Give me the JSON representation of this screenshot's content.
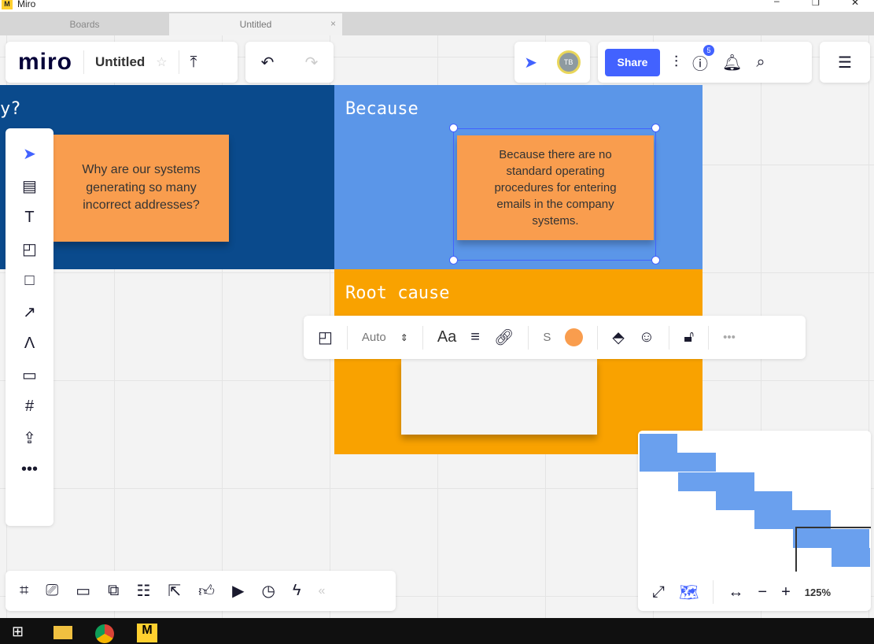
{
  "window": {
    "title": "Miro"
  },
  "tabs": [
    {
      "label": "Boards"
    },
    {
      "label": "Untitled"
    }
  ],
  "header": {
    "logo": "miro",
    "board_name": "Untitled",
    "share_label": "Share",
    "avatar_initials": "TB",
    "help_badge": "5"
  },
  "frames": [
    {
      "title": "y?"
    },
    {
      "title": "Because"
    },
    {
      "title": "Root cause"
    }
  ],
  "stickies": [
    {
      "text": "Why are our systems generating so many incorrect addresses?"
    },
    {
      "text": "Because there are no standard operating procedures for entering emails in the company systems."
    },
    {
      "text": ""
    }
  ],
  "context_toolbar": {
    "font_size": "Auto",
    "font_label": "Aa",
    "size_label": "S",
    "color": "#f99d4e"
  },
  "minimap": {
    "zoom": "125%"
  },
  "colors": {
    "frame_dark": "#0a4a8c",
    "frame_light": "#5b96e8",
    "frame_orange": "#f9a200",
    "accent": "#4262ff"
  }
}
